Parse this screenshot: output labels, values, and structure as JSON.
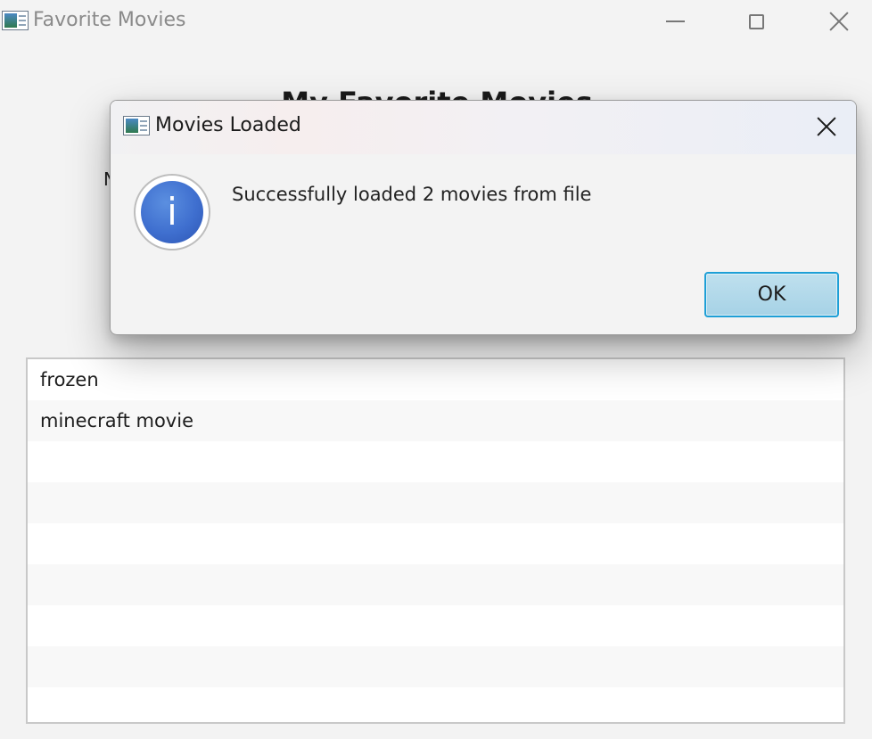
{
  "window": {
    "title": "Favorite Movies",
    "icon": "app-window-icon"
  },
  "main": {
    "heading": "My Favorite Movies",
    "field_label": "N",
    "list": {
      "items": [
        "frozen",
        "minecraft movie",
        "",
        "",
        "",
        "",
        "",
        "",
        ""
      ]
    }
  },
  "dialog": {
    "title": "Movies Loaded",
    "message": "Successfully loaded 2 movies from file",
    "icon": "info-icon",
    "info_glyph": "i",
    "ok_label": "OK"
  },
  "colors": {
    "accent": "#1e9fd6",
    "info_blue": "#3f6fcf",
    "window_bg": "#f3f3f3"
  }
}
